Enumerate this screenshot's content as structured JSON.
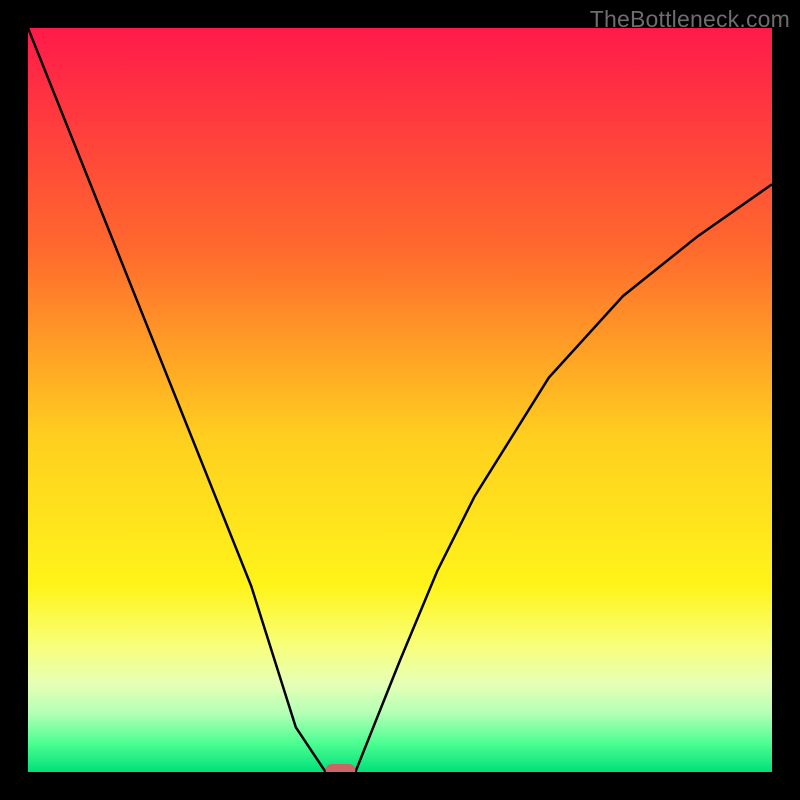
{
  "watermark": "TheBottleneck.com",
  "chart_data": {
    "type": "line",
    "x": [
      0,
      10,
      20,
      30,
      36,
      40,
      42,
      44,
      46,
      50,
      55,
      60,
      70,
      80,
      90,
      100
    ],
    "series": [
      {
        "name": "bottleneck_curve",
        "values": [
          100,
          75,
          50,
          25,
          6,
          0,
          0,
          0,
          5,
          15,
          27,
          37,
          53,
          64,
          72,
          79
        ]
      }
    ],
    "xlabel": "",
    "ylabel": "",
    "xlim": [
      0,
      100
    ],
    "ylim": [
      0,
      100
    ],
    "marker": {
      "x_start": 40,
      "x_end": 44,
      "y": 0
    },
    "gradient_stops": [
      {
        "offset": 0,
        "color": "#ff1a4a"
      },
      {
        "offset": 30,
        "color": "#ff6a2d"
      },
      {
        "offset": 55,
        "color": "#ffcf1f"
      },
      {
        "offset": 75,
        "color": "#fff41a"
      },
      {
        "offset": 83,
        "color": "#f8ff7a"
      },
      {
        "offset": 88,
        "color": "#e7ffb5"
      },
      {
        "offset": 92,
        "color": "#b6ffb6"
      },
      {
        "offset": 96,
        "color": "#4fff93"
      },
      {
        "offset": 100,
        "color": "#00e07a"
      }
    ],
    "marker_color": "#cc6666"
  }
}
